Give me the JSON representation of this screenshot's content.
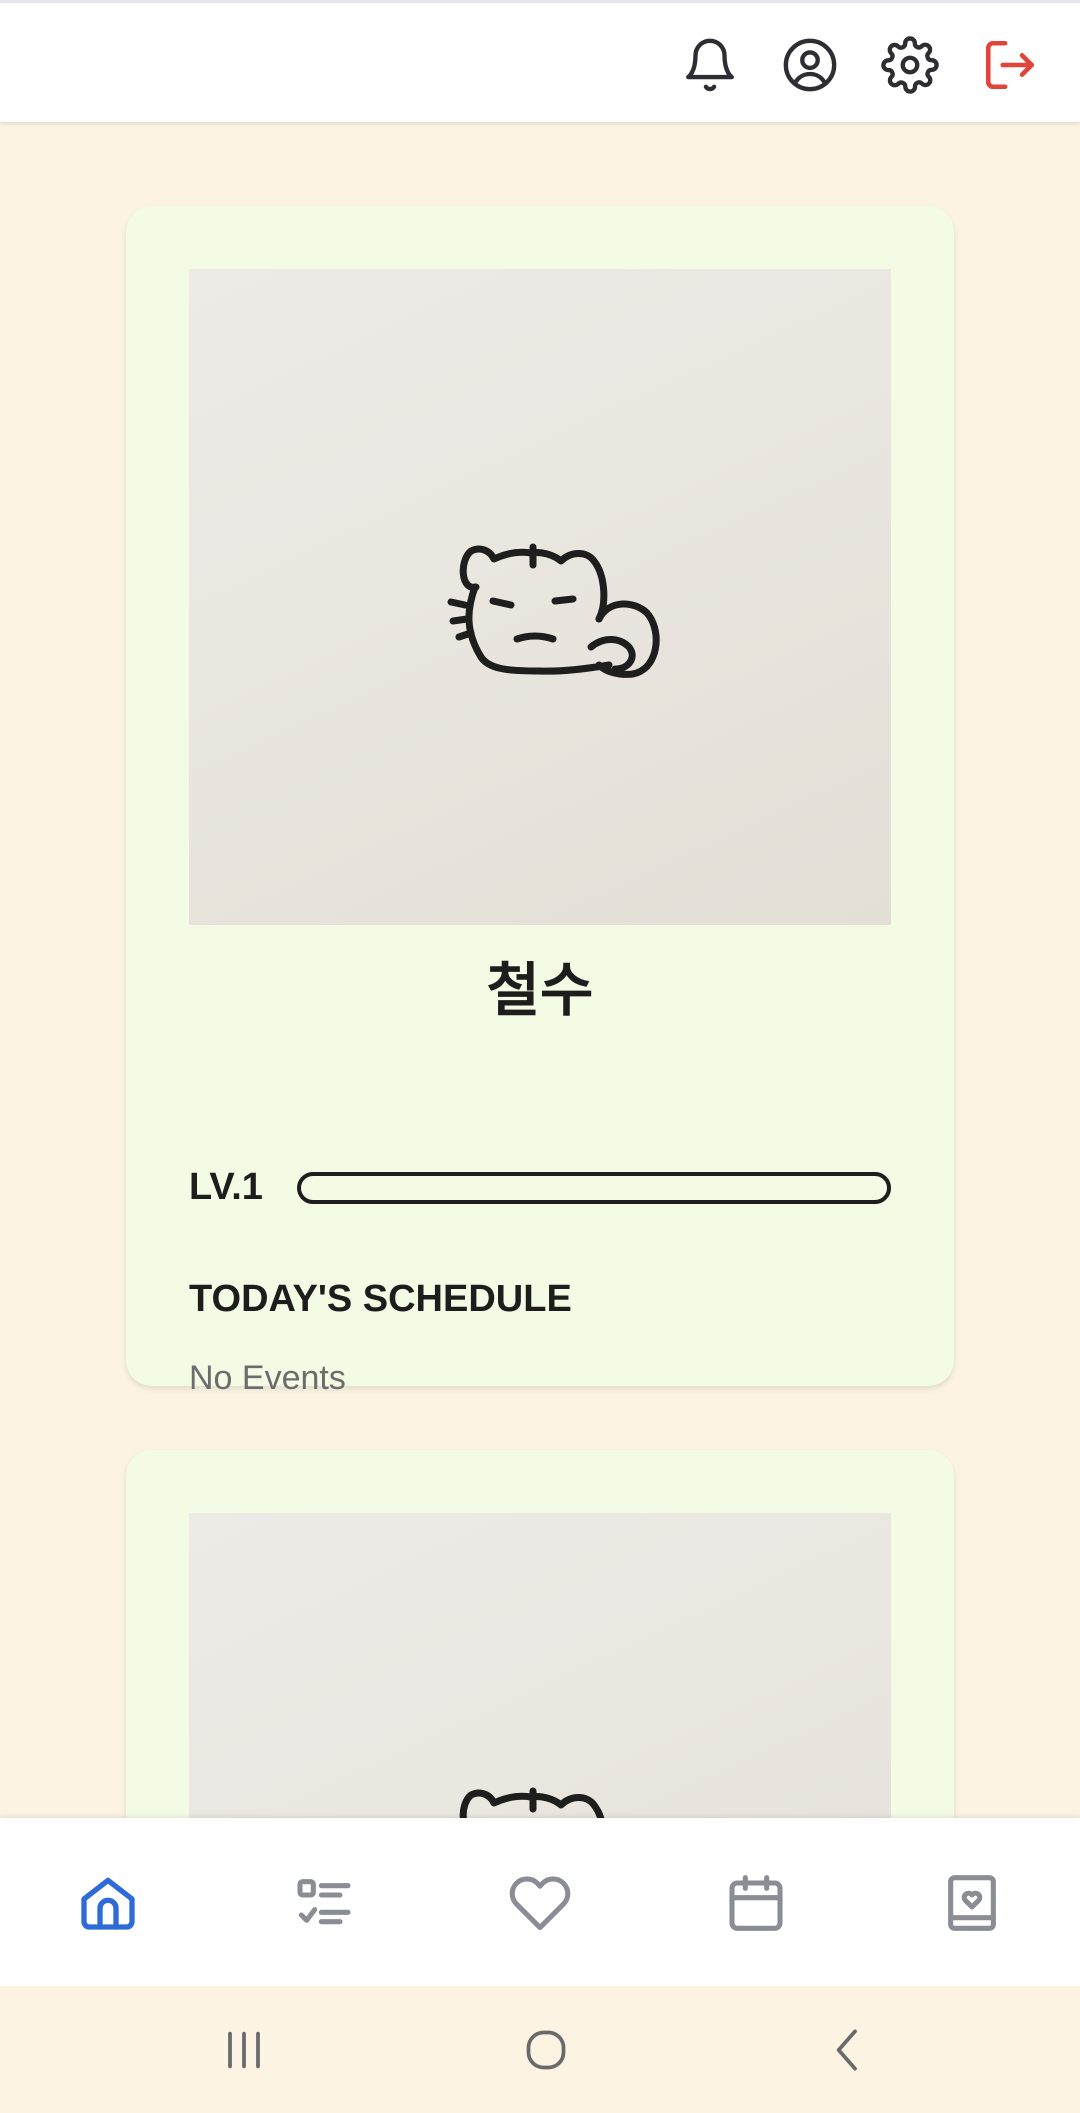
{
  "header": {
    "icons": [
      "bell-icon",
      "user-circle-icon",
      "gear-icon",
      "logout-icon"
    ],
    "logout_color": "#e0443a",
    "icon_color": "#2d2d33"
  },
  "pets": [
    {
      "name": "철수",
      "level_label": "LV.1",
      "level_progress": 0,
      "schedule_title": "TODAY'S SCHEDULE",
      "schedule_empty": "No Events"
    },
    {
      "name": "",
      "level_label": "",
      "level_progress": 0,
      "schedule_title": "",
      "schedule_empty": ""
    }
  ],
  "bottom_nav": {
    "items": [
      "home-icon",
      "checklist-icon",
      "heart-icon",
      "calendar-icon",
      "diary-icon"
    ],
    "active": "home-icon",
    "active_color": "#2f6bd8",
    "inactive_color": "#8a8d94"
  },
  "system_nav": {
    "buttons": [
      "recent-apps-icon",
      "home-circle-icon",
      "back-icon"
    ]
  },
  "colors": {
    "background": "#fcf3e2",
    "card": "#f3fbe5",
    "text": "#1d1d1d",
    "muted_text": "#6c6c6c"
  }
}
